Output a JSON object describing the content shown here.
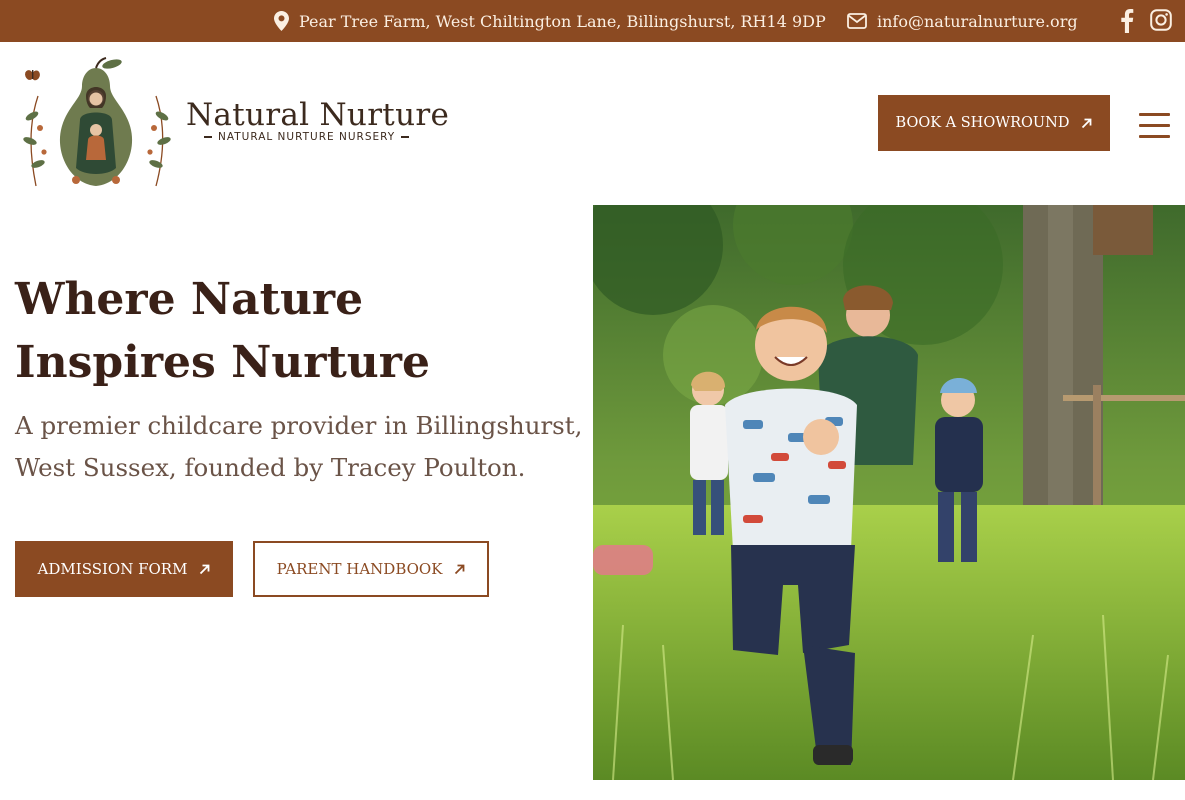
{
  "topbar": {
    "address": "Pear Tree Farm, West Chiltington Lane, Billingshurst, RH14 9DP",
    "email": "info@naturalnurture.org",
    "icons": [
      "location-pin-icon",
      "envelope-icon",
      "facebook-icon",
      "instagram-icon"
    ]
  },
  "header": {
    "brand_name": "Natural Nurture",
    "brand_tagline": "NATURAL NURTURE NURSERY",
    "book_button": "BOOK A SHOWROUND",
    "menu_icon": "hamburger-menu-icon"
  },
  "hero": {
    "title": "Where Nature Inspires Nurture",
    "subtitle": "A premier childcare provider in Billingshurst, West Sussex, founded by Tracey Poulton.",
    "admission_button": "ADMISSION FORM",
    "handbook_button": "PARENT HANDBOOK"
  },
  "colors": {
    "brand_brown": "#8b4a22",
    "heading_dark": "#3a2118",
    "subtitle_text": "#6a5347",
    "topbar_text": "#fbefe2"
  }
}
